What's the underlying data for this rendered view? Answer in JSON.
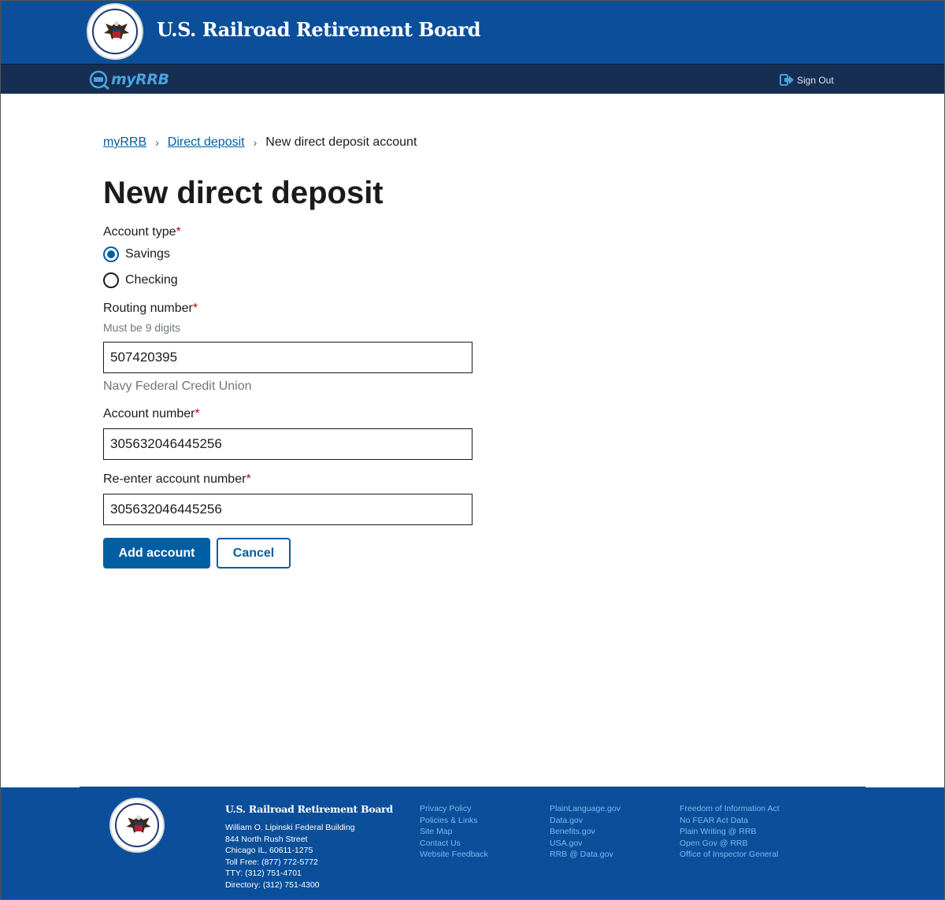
{
  "header": {
    "site_title": "U.S. Railroad Retirement Board",
    "seal_text": "RAILROAD RETIREMENT BOARD · U.S.A."
  },
  "subnav": {
    "logo_text": "myRRB",
    "sign_out": "Sign Out"
  },
  "breadcrumb": {
    "items": [
      "myRRB",
      "Direct deposit"
    ],
    "current": "New direct deposit account"
  },
  "page": {
    "title": "New direct deposit"
  },
  "form": {
    "account_type": {
      "label": "Account type",
      "required_mark": "*",
      "options": [
        "Savings",
        "Checking"
      ],
      "selected": "Savings"
    },
    "routing": {
      "label": "Routing number",
      "required_mark": "*",
      "hint": "Must be 9 digits",
      "value": "507420395",
      "bank_name": "Navy Federal Credit Union"
    },
    "account": {
      "label": "Account number",
      "required_mark": "*",
      "value": "305632046445256"
    },
    "reenter": {
      "label": "Re-enter account number",
      "required_mark": "*",
      "value": "305632046445256"
    },
    "buttons": {
      "submit": "Add account",
      "cancel": "Cancel"
    }
  },
  "footer": {
    "org_name": "U.S. Railroad Retirement Board",
    "address": [
      "William O. Lipinski Federal Building",
      "844 North Rush Street",
      "Chicago IL, 60611-1275",
      "Toll Free: (877) 772-5772",
      "TTY: (312) 751-4701",
      "Directory: (312) 751-4300"
    ],
    "links_col1": [
      "Privacy Policy",
      "Policies & Links",
      "Site Map",
      "Contact Us",
      "Website Feedback"
    ],
    "links_col2": [
      "PlainLanguage.gov",
      "Data.gov",
      "Benefits.gov",
      "USA.gov",
      "RRB @ Data.gov"
    ],
    "links_col3": [
      "Freedom of Information Act",
      "No FEAR Act Data",
      "Plain Writing @ RRB",
      "Open Gov @ RRB",
      "Office of Inspector General"
    ]
  },
  "colors": {
    "header_blue": "#0b4f9b",
    "subnav_navy": "#162e51",
    "primary": "#005ea2",
    "required": "#b50909"
  }
}
